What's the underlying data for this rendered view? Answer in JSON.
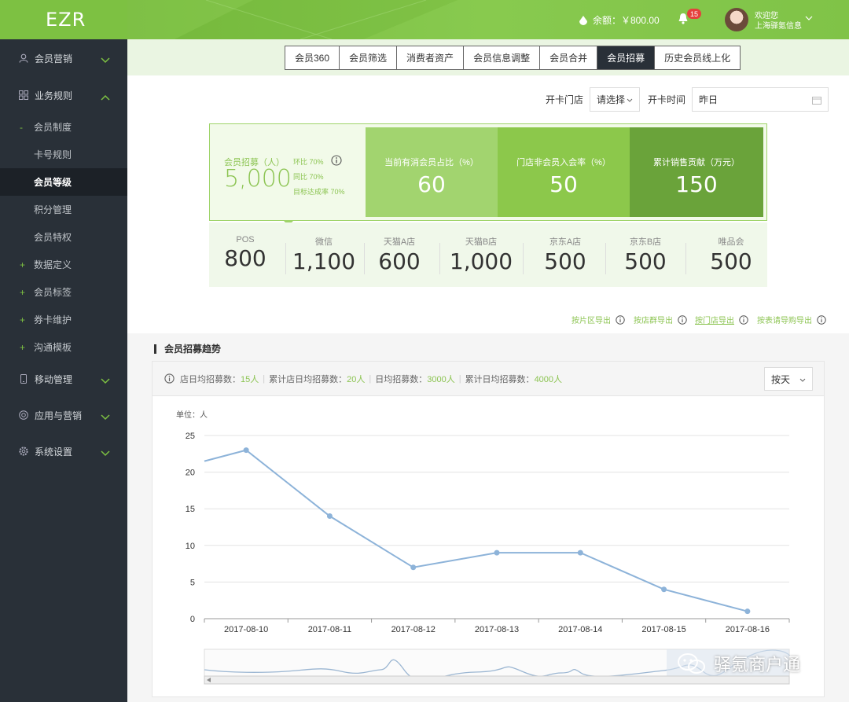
{
  "app": {
    "logo": "EZR"
  },
  "sidebar": {
    "items": [
      {
        "label": "会员营销",
        "icon": "user-icon"
      },
      {
        "label": "业务规则",
        "icon": "grid-icon",
        "expanded": true
      },
      {
        "label": "移动管理",
        "icon": "mobile-icon"
      },
      {
        "label": "应用与营销",
        "icon": "target-icon"
      },
      {
        "label": "系统设置",
        "icon": "gear-icon"
      }
    ],
    "subitems": [
      {
        "label": "会员制度",
        "marker": "-"
      },
      {
        "label": "卡号规则",
        "marker": ""
      },
      {
        "label": "会员等级",
        "marker": "",
        "active": true
      },
      {
        "label": "积分管理",
        "marker": ""
      },
      {
        "label": "会员特权",
        "marker": ""
      },
      {
        "label": "数据定义",
        "marker": "+"
      },
      {
        "label": "会员标签",
        "marker": "+"
      },
      {
        "label": "券卡维护",
        "marker": "+"
      },
      {
        "label": "沟通模板",
        "marker": "+"
      }
    ]
  },
  "topbar": {
    "balance": "余额：￥800.00",
    "notifications": "15",
    "welcome": "欢迎您",
    "company": "上海驿氪信息"
  },
  "tabs": [
    "会员360",
    "会员筛选",
    "消费者资产",
    "会员信息调整",
    "会员合并",
    "会员招募",
    "历史会员线上化"
  ],
  "active_tab": "会员招募",
  "filters": {
    "store_label": "开卡门店",
    "store_value": "请选择",
    "time_label": "开卡时间",
    "time_value": "昨日"
  },
  "stats": {
    "recruit_label": "会员招募（人）",
    "recruit_value": "5,000",
    "yoy": "环比 70%",
    "mom": "同比 70%",
    "target": "目标达成率 70%",
    "boxes": [
      {
        "label": "当前有消会员占比（%）",
        "value": "60",
        "color": "#a2d46f"
      },
      {
        "label": "门店非会员入会率（%）",
        "value": "50",
        "color": "#8cc84b"
      },
      {
        "label": "累计销售贡献（万元）",
        "value": "150",
        "color": "#6aa33a"
      }
    ]
  },
  "channels": [
    {
      "label": "POS",
      "value": "800"
    },
    {
      "label": "微信",
      "value": "1,100"
    },
    {
      "label": "天猫A店",
      "value": "600"
    },
    {
      "label": "天猫B店",
      "value": "1,000"
    },
    {
      "label": "京东A店",
      "value": "500"
    },
    {
      "label": "京东B店",
      "value": "500"
    },
    {
      "label": "唯品会",
      "value": "500"
    }
  ],
  "exports": [
    "按片区导出",
    "按店群导出",
    "按门店导出",
    "按表请导购导出"
  ],
  "trend": {
    "title": "会员招募趋势",
    "s1_label": "店日均招募数：",
    "s1_value": "15人",
    "s2_label": "累计店日均招募数：",
    "s2_value": "20人",
    "s3_label": "日均招募数：",
    "s3_value": "3000人",
    "s4_label": "累计日均招募数：",
    "s4_value": "4000人",
    "period": "按天",
    "unit": "单位：人"
  },
  "chart_data": {
    "type": "line",
    "x": [
      "2017-08-10",
      "2017-08-11",
      "2017-08-12",
      "2017-08-13",
      "2017-08-14",
      "2017-08-15",
      "2017-08-16"
    ],
    "series": [
      {
        "values": [
          23,
          14,
          7,
          9,
          9,
          4,
          1
        ]
      }
    ],
    "lead_in_value": 21.5,
    "ylim": [
      0,
      25
    ],
    "yticks": [
      0,
      5,
      10,
      15,
      20,
      25
    ],
    "grid": true,
    "color": "#8db3d9",
    "has_zoom_slider": true
  },
  "watermark": "驿氪商户通"
}
